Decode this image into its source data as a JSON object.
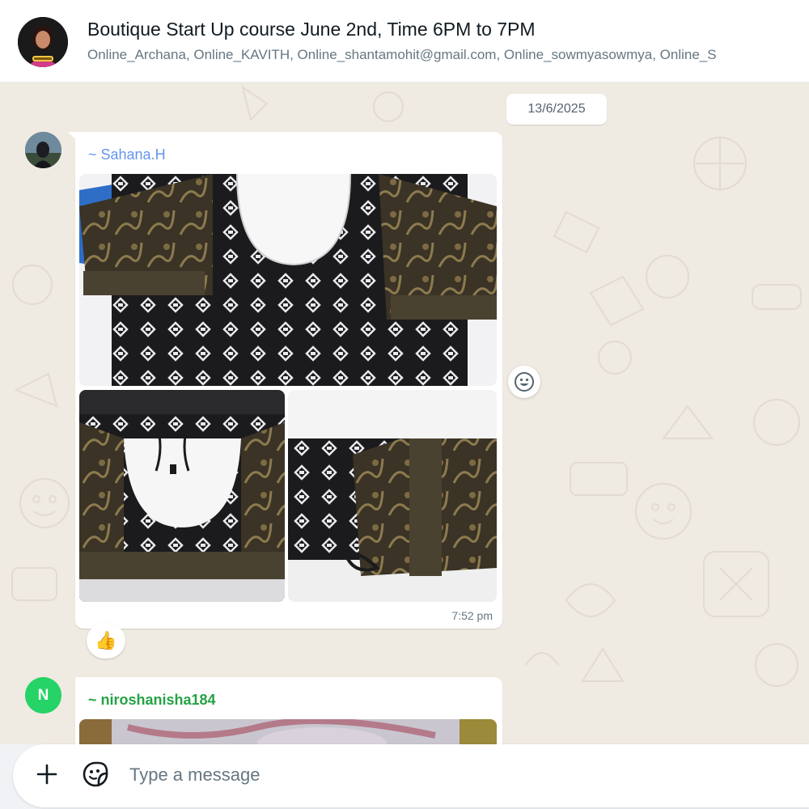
{
  "header": {
    "title": "Boutique Start Up course June 2nd, Time 6PM to 7PM",
    "participants": "Online_Archana, Online_KAVITH, Online_shantamohit@gmail.com, Online_sowmyasowmya, Online_S",
    "avatar_icon": "group-avatar-icon"
  },
  "chat": {
    "date": "13/6/2025",
    "messages": [
      {
        "sender": "~ Sahana.H",
        "sender_color": "#6495ed",
        "type": "image-album",
        "time": "7:52 pm",
        "reaction": "👍"
      },
      {
        "sender": "~ niroshanisha184",
        "sender_color": "#25a244",
        "avatar_letter": "N",
        "type": "image"
      }
    ]
  },
  "composer": {
    "placeholder": "Type a message",
    "attach_icon": "plus-icon",
    "sticker_icon": "sticker-icon",
    "emoji_icon": "emoji-icon"
  },
  "colors": {
    "background": "#efeae2",
    "accent": "#25d366",
    "bubble": "#ffffff"
  }
}
